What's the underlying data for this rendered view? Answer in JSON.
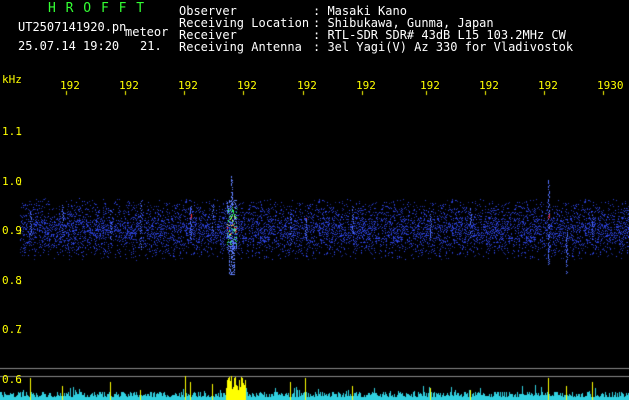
{
  "header": {
    "brand": "H R O F F T",
    "filename": "UT2507141920.pn",
    "tag": "meteor",
    "datetime": "25.07.14 19:20",
    "index": "21.",
    "fields": [
      {
        "label": "Observer",
        "value": ": Masaki Kano"
      },
      {
        "label": "Receiving Location",
        "value": ": Shibukawa, Gunma, Japan"
      },
      {
        "label": "Receiver",
        "value": ": RTL-SDR SDR# 43dB L15 103.2MHz CW"
      },
      {
        "label": "Receiving Antenna",
        "value": ": 3el Yagi(V) Az 330 for Vladivostok"
      }
    ]
  },
  "axes": {
    "y_unit": "kHz",
    "y_ticks": [
      "1.1",
      "1.0",
      "0.9",
      "0.8",
      "0.7",
      "0.6"
    ],
    "x_ticks": [
      "192",
      "192",
      "192",
      "192",
      "192",
      "192",
      "192",
      "192",
      "192",
      "1930"
    ]
  },
  "colors": {
    "background": "#000000",
    "label": "#ffffff",
    "axis": "#ffff00",
    "brand": "#33ff33",
    "noise": "#2030c0",
    "hot": "#ff2020"
  }
}
